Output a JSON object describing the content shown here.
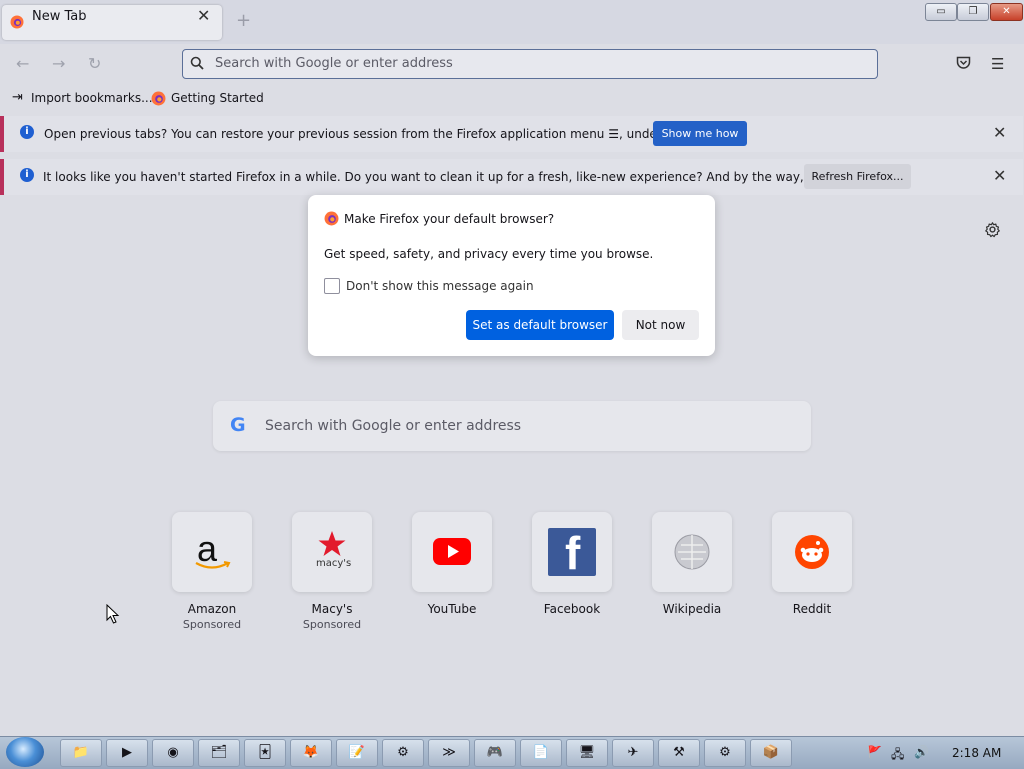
{
  "tab": {
    "title": "New Tab",
    "close_glyph": "✕",
    "new_tab_glyph": "+"
  },
  "window_controls": {
    "minimize": "▭",
    "maximize": "❐",
    "close": "✕"
  },
  "nav": {
    "back_icon": "←",
    "forward_icon": "→",
    "reload_icon": "↻",
    "url_placeholder": "Search with Google or enter address",
    "pocket_icon": "pocket-icon",
    "menu_icon": "☰"
  },
  "bookmarks": [
    {
      "label": "Import bookmarks...",
      "icon": "import-icon"
    },
    {
      "label": "Getting Started",
      "icon": "firefox-icon"
    }
  ],
  "infobars": [
    {
      "text": "Open previous tabs? You can restore your previous session from the Firefox application menu ☰, under History.",
      "button": "Show me how"
    },
    {
      "text": "It looks like you haven't started Firefox in a while. Do you want to clean it up for a fresh, like-new experience? And by the way, welcome back!",
      "button": "Refresh Firefox..."
    }
  ],
  "dialog": {
    "title": "Make Firefox your default browser?",
    "body": "Get speed, safety, and privacy every time you browse.",
    "checkbox_label": "Don't show this message again",
    "checkbox_checked": false,
    "primary_button": "Set as default browser",
    "secondary_button": "Not now"
  },
  "main_search": {
    "placeholder": "Search with Google or enter address",
    "g_letter": "G"
  },
  "top_sites": [
    {
      "title": "Amazon",
      "sub": "Sponsored",
      "icon": "amazon-icon"
    },
    {
      "title": "Macy's",
      "sub": "Sponsored",
      "icon": "macys-icon"
    },
    {
      "title": "YouTube",
      "sub": "",
      "icon": "youtube-icon"
    },
    {
      "title": "Facebook",
      "sub": "",
      "icon": "facebook-icon"
    },
    {
      "title": "Wikipedia",
      "sub": "",
      "icon": "wikipedia-icon"
    },
    {
      "title": "Reddit",
      "sub": "",
      "icon": "reddit-icon"
    }
  ],
  "macys_text": "macy's",
  "amazon_text": "a",
  "facebook_text": "f",
  "taskbar": {
    "clock": "2:18 AM",
    "items": [
      "📁",
      "▶",
      "◉",
      "🗂",
      "🃏",
      "🦊",
      "📝",
      "⚙",
      "≫",
      "🎮",
      "📄",
      "🖥",
      "✈",
      "⚒",
      "⚙",
      "📦"
    ]
  },
  "colors": {
    "accent": "#0061e0",
    "infobar_stripe": "#b8305b",
    "info_icon": "#1f5fd1"
  }
}
